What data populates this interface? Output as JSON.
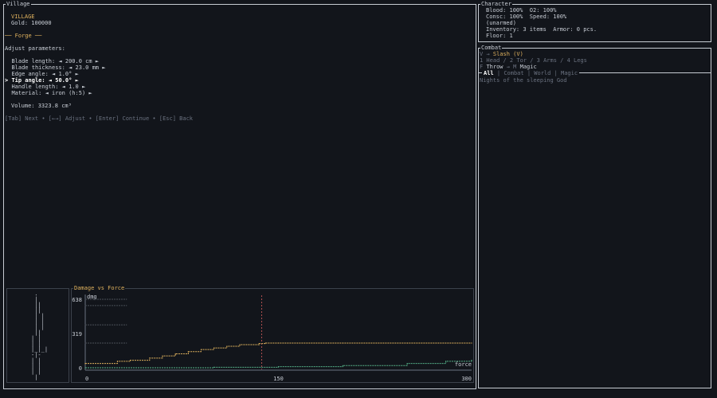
{
  "village": {
    "panel_title": "Village",
    "heading": "VILLAGE",
    "gold": "Gold: 100000",
    "forge_title": "── Forge ──",
    "adjust_label": "Adjust parameters:",
    "params": [
      {
        "prefix": "  ",
        "text": "Blade length: ◄ 200.0 cm ►",
        "selected": false
      },
      {
        "prefix": "  ",
        "text": "Blade thickness: ◄ 23.0 mm ►",
        "selected": false
      },
      {
        "prefix": "  ",
        "text": "Edge angle: ◄ 1.0° ►",
        "selected": false
      },
      {
        "prefix": "> ",
        "text": "Tip angle: ◄ 50.0° ►",
        "selected": true
      },
      {
        "prefix": "  ",
        "text": "Handle length: ◄ 1.0 ►",
        "selected": false
      },
      {
        "prefix": "  ",
        "text": "Material: ◄ iron (h:5) ►",
        "selected": false
      }
    ],
    "volume": "Volume: 3323.8 cm³",
    "help": "[Tab] Next • [←→] Adjust • [Enter] Continue • [Esc] Back"
  },
  "blade_preview": {
    "lines": [
      " .",
      " |",
      " ||",
      " ||",
      " | |",
      " | |",
      " | |",
      " ||",
      "| |",
      "| |",
      "|_|_|",
      "-|-",
      "| |",
      "| |",
      "| |",
      " |"
    ]
  },
  "chart_panel_title": "Damage vs Force",
  "character": {
    "panel_title": "Character",
    "lines": [
      "Blood: 100%  O2: 100%",
      "Consc: 100%  Speed: 100%",
      "(unarmed)",
      "Inventory: 3 items  Armor: 0 pcs.",
      "Floor: 1"
    ]
  },
  "combat": {
    "panel_title": "Combat",
    "attack_key": "V",
    "attack_sep": "→",
    "attack_label": "Slash (V)",
    "targets": "1 Head / 2 Tor / 3 Arms / 4 Legs",
    "throw_key": "F",
    "throw_label": "Throw",
    "magic_sep": "→",
    "magic_key": "M",
    "magic_label": "Magic"
  },
  "log": {
    "tabs": [
      "All",
      "Combat",
      "World",
      "Magic"
    ],
    "active_tab": "All",
    "entries": [
      "Nights of the sleeping God"
    ]
  },
  "colors": {
    "background": "#12151b",
    "border": "#c7ccd3",
    "accent": "#e0b25e",
    "series_damage": "#e0b25e",
    "series_alt": "#56b38a",
    "marker": "#b05050"
  },
  "chart_data": {
    "type": "line",
    "title": "Damage vs Force",
    "xlabel": "force",
    "ylabel": "dmg",
    "xlim": [
      0,
      300
    ],
    "ylim": [
      0,
      638
    ],
    "xticks": [
      0,
      150,
      300
    ],
    "yticks": [
      0,
      319,
      638
    ],
    "marker_x": 137,
    "series": [
      {
        "color": "orange",
        "x": [
          0,
          25,
          35,
          50,
          60,
          70,
          80,
          90,
          100,
          110,
          120,
          135,
          140,
          150,
          200,
          250,
          300
        ],
        "values": [
          40,
          60,
          70,
          90,
          110,
          130,
          150,
          170,
          185,
          200,
          215,
          225,
          230,
          230,
          230,
          230,
          230
        ]
      },
      {
        "color": "green",
        "x": [
          0,
          100,
          150,
          200,
          250,
          280,
          300
        ],
        "values": [
          0,
          5,
          10,
          20,
          40,
          60,
          70
        ]
      },
      {
        "color": "dim",
        "x": [
          0,
          32
        ],
        "values": [
          638,
          638
        ]
      },
      {
        "color": "dim",
        "x": [
          0,
          32
        ],
        "values": [
          580,
          580
        ]
      },
      {
        "color": "dim",
        "x": [
          0,
          32
        ],
        "values": [
          400,
          400
        ]
      },
      {
        "color": "dim",
        "x": [
          0,
          32
        ],
        "values": [
          230,
          230
        ]
      }
    ]
  }
}
